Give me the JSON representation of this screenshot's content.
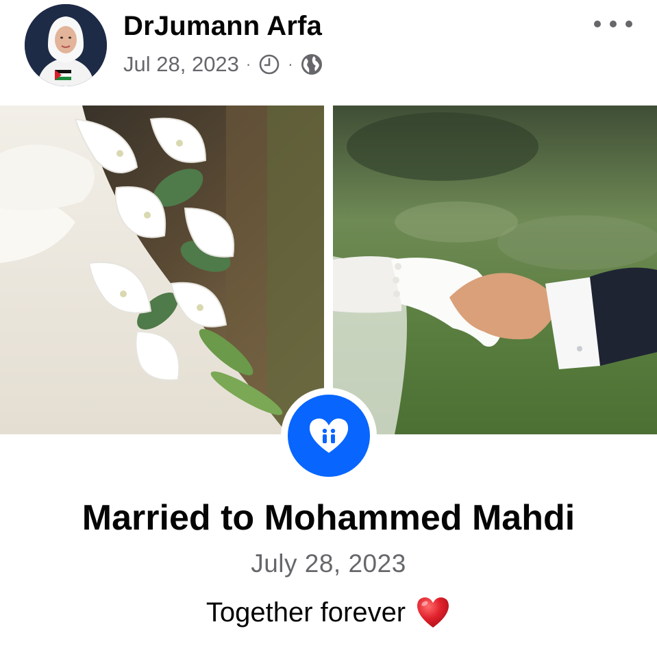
{
  "post": {
    "author": {
      "name": "DrJumann Arfa",
      "avatar_icon": "profile-photo"
    },
    "meta": {
      "date": "Jul 28, 2023",
      "separator": "·",
      "clock_icon": "clock-icon",
      "audience_icon": "globe-icon"
    },
    "more_icon": "more-horizontal-icon",
    "photos": [
      {
        "name": "bride-bouquet-photo"
      },
      {
        "name": "holding-hands-photo"
      }
    ],
    "life_event": {
      "icon": "heart-couple-icon",
      "title": "Married to Mohammed Mahdi",
      "date": "July 28, 2023"
    },
    "caption": {
      "text": "Together forever",
      "emoji": "❤️"
    }
  },
  "colors": {
    "primary_text": "#050505",
    "secondary_text": "#65676b",
    "accent": "#0866ff",
    "heart": "#e0212c"
  }
}
